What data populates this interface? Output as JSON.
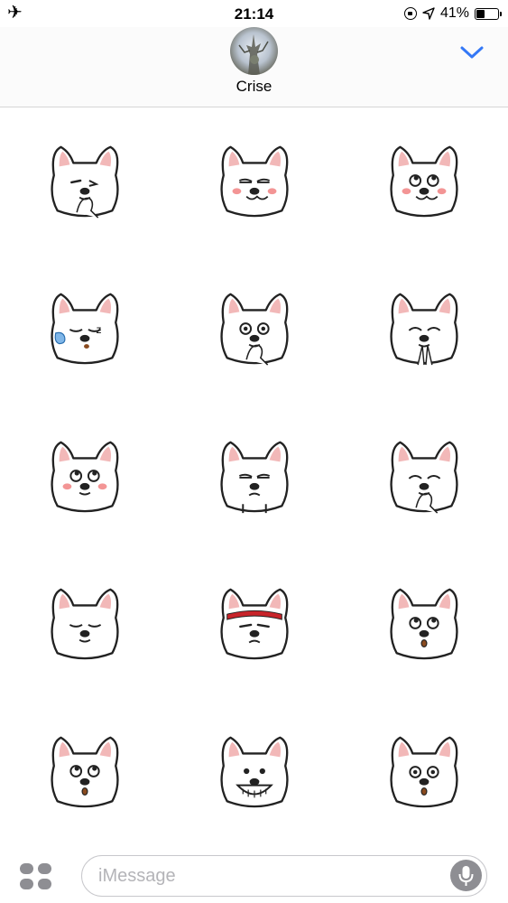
{
  "status_bar": {
    "time": "21:14",
    "battery": "41%",
    "battery_fraction": 0.41
  },
  "header": {
    "contact_name": "Crise"
  },
  "stickers": [
    {
      "id": 1,
      "expression": "skeptical"
    },
    {
      "id": 2,
      "expression": "smirk"
    },
    {
      "id": 3,
      "expression": "blush"
    },
    {
      "id": 4,
      "expression": "sleepy"
    },
    {
      "id": 5,
      "expression": "shocked"
    },
    {
      "id": 6,
      "expression": "pray"
    },
    {
      "id": 7,
      "expression": "blush-eyes-up"
    },
    {
      "id": 8,
      "expression": "annoyed"
    },
    {
      "id": 9,
      "expression": "giggle"
    },
    {
      "id": 10,
      "expression": "hmph"
    },
    {
      "id": 11,
      "expression": "headband"
    },
    {
      "id": 12,
      "expression": "wonder"
    },
    {
      "id": 13,
      "expression": "eyes-up"
    },
    {
      "id": 14,
      "expression": "grin"
    },
    {
      "id": 15,
      "expression": "dizzy"
    }
  ],
  "composer": {
    "placeholder": "iMessage"
  },
  "colors": {
    "accent": "#3478f6",
    "ear_pink": "#f2b8b8",
    "blush": "#f07b7b",
    "headband": "#c8242a"
  }
}
